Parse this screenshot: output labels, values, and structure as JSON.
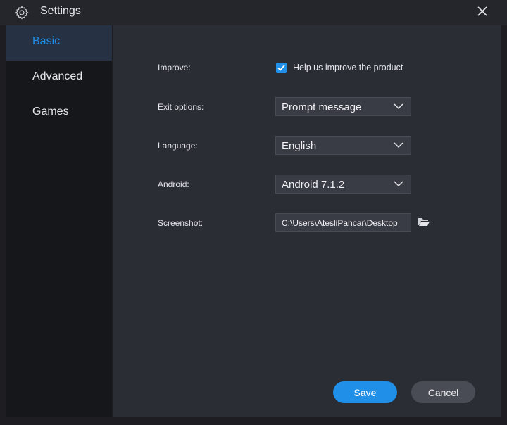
{
  "window": {
    "title": "Settings",
    "title_icon": "gear-icon",
    "close_icon": "close-icon"
  },
  "sidebar": {
    "items": [
      {
        "label": "Basic",
        "active": true
      },
      {
        "label": "Advanced",
        "active": false
      },
      {
        "label": "Games",
        "active": false
      }
    ]
  },
  "form": {
    "improve": {
      "label": "Improve:",
      "checkbox_label": "Help us improve the product",
      "checked": true
    },
    "exit_options": {
      "label": "Exit options:",
      "value": "Prompt message"
    },
    "language": {
      "label": "Language:",
      "value": "English"
    },
    "android": {
      "label": "Android:",
      "value": "Android 7.1.2"
    },
    "screenshot": {
      "label": "Screenshot:",
      "value": "C:\\Users\\AtesliPancar\\Desktop"
    }
  },
  "buttons": {
    "save": "Save",
    "cancel": "Cancel"
  },
  "colors": {
    "accent": "#1f8fe8",
    "sidebar_bg": "#16171b",
    "main_bg": "#2b2d35",
    "titlebar_bg": "#25262b"
  }
}
